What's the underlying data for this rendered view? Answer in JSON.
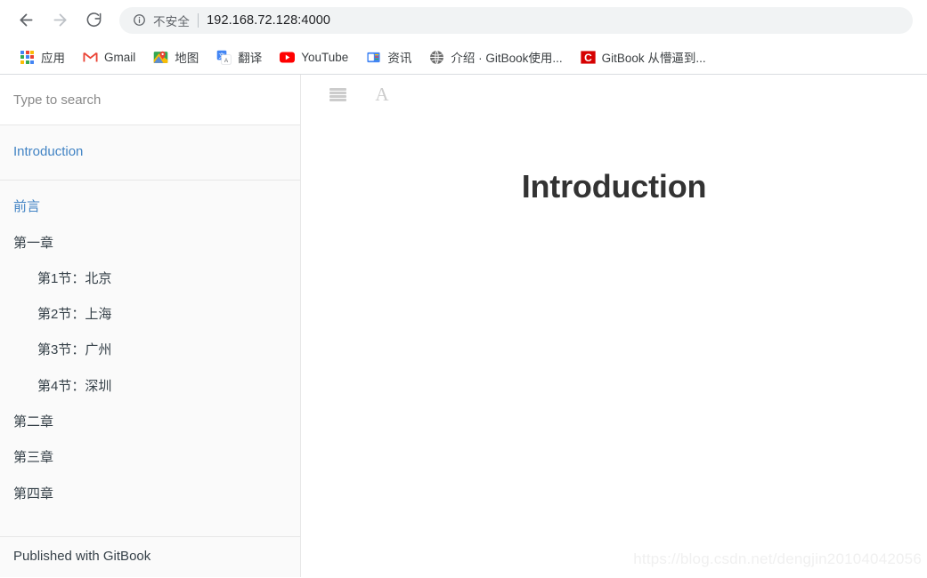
{
  "browser": {
    "nav": {
      "back_icon": "arrow-left-icon",
      "forward_icon": "arrow-right-icon",
      "reload_icon": "reload-icon"
    },
    "omnibox": {
      "security_icon": "info-circle-icon",
      "security_label": "不安全",
      "url": "192.168.72.128:4000"
    },
    "bookmarks": [
      {
        "label": "应用",
        "icon": "google-apps-grid-icon"
      },
      {
        "label": "Gmail",
        "icon": "gmail-icon"
      },
      {
        "label": "地图",
        "icon": "google-maps-icon"
      },
      {
        "label": "翻译",
        "icon": "google-translate-icon"
      },
      {
        "label": "YouTube",
        "icon": "youtube-icon"
      },
      {
        "label": "资讯",
        "icon": "google-news-icon"
      },
      {
        "label": "介绍 · GitBook使用...",
        "icon": "globe-icon"
      },
      {
        "label": "GitBook 从懵逼到...",
        "icon": "csdn-icon"
      }
    ]
  },
  "gitbook": {
    "search": {
      "placeholder": "Type to search",
      "value": ""
    },
    "summary_top": [
      {
        "label": "Introduction",
        "active": true,
        "indent": 0
      }
    ],
    "summary": [
      {
        "label": "前言",
        "active": true,
        "indent": 0
      },
      {
        "label": "第一章",
        "active": false,
        "indent": 0
      },
      {
        "label": "第1节：北京",
        "active": false,
        "indent": 1
      },
      {
        "label": "第2节：上海",
        "active": false,
        "indent": 1
      },
      {
        "label": "第3节：广州",
        "active": false,
        "indent": 1
      },
      {
        "label": "第4节：深圳",
        "active": false,
        "indent": 1
      },
      {
        "label": "第二章",
        "active": false,
        "indent": 0
      },
      {
        "label": "第三章",
        "active": false,
        "indent": 0
      },
      {
        "label": "第四章",
        "active": false,
        "indent": 0
      }
    ],
    "footer": {
      "label": "Published with GitBook"
    },
    "toolbar": {
      "menu_icon": "hamburger-menu-icon",
      "font_icon": "font-size-A-icon"
    },
    "content": {
      "title": "Introduction"
    },
    "watermark": "https://blog.csdn.net/dengjin20104042056"
  },
  "colors": {
    "link_blue": "#4183c4",
    "text": "#364149",
    "sidebar_bg": "#fafafa",
    "border": "#e7e7e7"
  }
}
